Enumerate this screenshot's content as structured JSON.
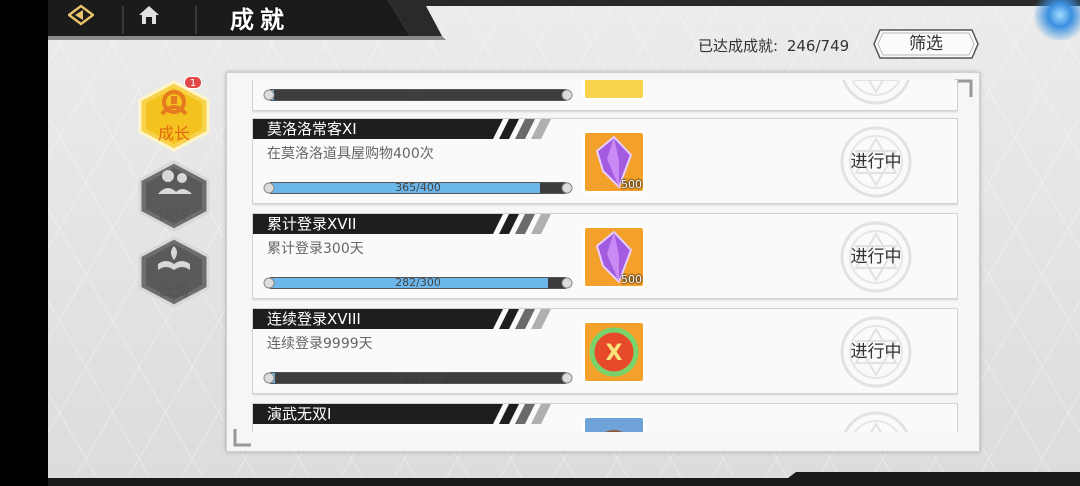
{
  "header": {
    "title": "成就"
  },
  "summary": {
    "label": "已达成成就:",
    "value": "246/749"
  },
  "filter": {
    "label": "筛选"
  },
  "sidebar": {
    "items": [
      {
        "label": "成长",
        "active": true,
        "badge": "1",
        "icon": "growth-icon"
      },
      {
        "label": "伙伴",
        "active": false,
        "icon": "partner-icon"
      },
      {
        "label": "任务",
        "active": false,
        "icon": "task-icon"
      }
    ]
  },
  "achievements": [
    {
      "title": "",
      "desc": "",
      "progress": "0/5",
      "fraction": 0,
      "reward_icon": "gold-gem-icon",
      "reward_count": "",
      "status": ""
    },
    {
      "title": "莫洛洛常客XI",
      "desc": "在莫洛洛道具屋购物400次",
      "progress": "365/400",
      "fraction": 0.9125,
      "reward_icon": "purple-crystal-icon",
      "reward_count": "500",
      "status": "进行中"
    },
    {
      "title": "累计登录XVII",
      "desc": "累计登录300天",
      "progress": "282/300",
      "fraction": 0.94,
      "reward_icon": "purple-crystal-icon",
      "reward_count": "500",
      "status": "进行中"
    },
    {
      "title": "连续登录XVIII",
      "desc": "连续登录9999天",
      "progress": "181/9999",
      "fraction": 0.018,
      "reward_icon": "x-medal-icon",
      "reward_count": "",
      "status": "进行中"
    },
    {
      "title": "演武无双I",
      "desc": "",
      "progress": "",
      "fraction": 0,
      "reward_icon": "portrait-icon",
      "reward_count": "",
      "status": ""
    }
  ],
  "colors": {
    "accent_gold": "#f2c230",
    "progress_blue": "#6bb6ea",
    "title_bar": "#1e1e1e"
  }
}
